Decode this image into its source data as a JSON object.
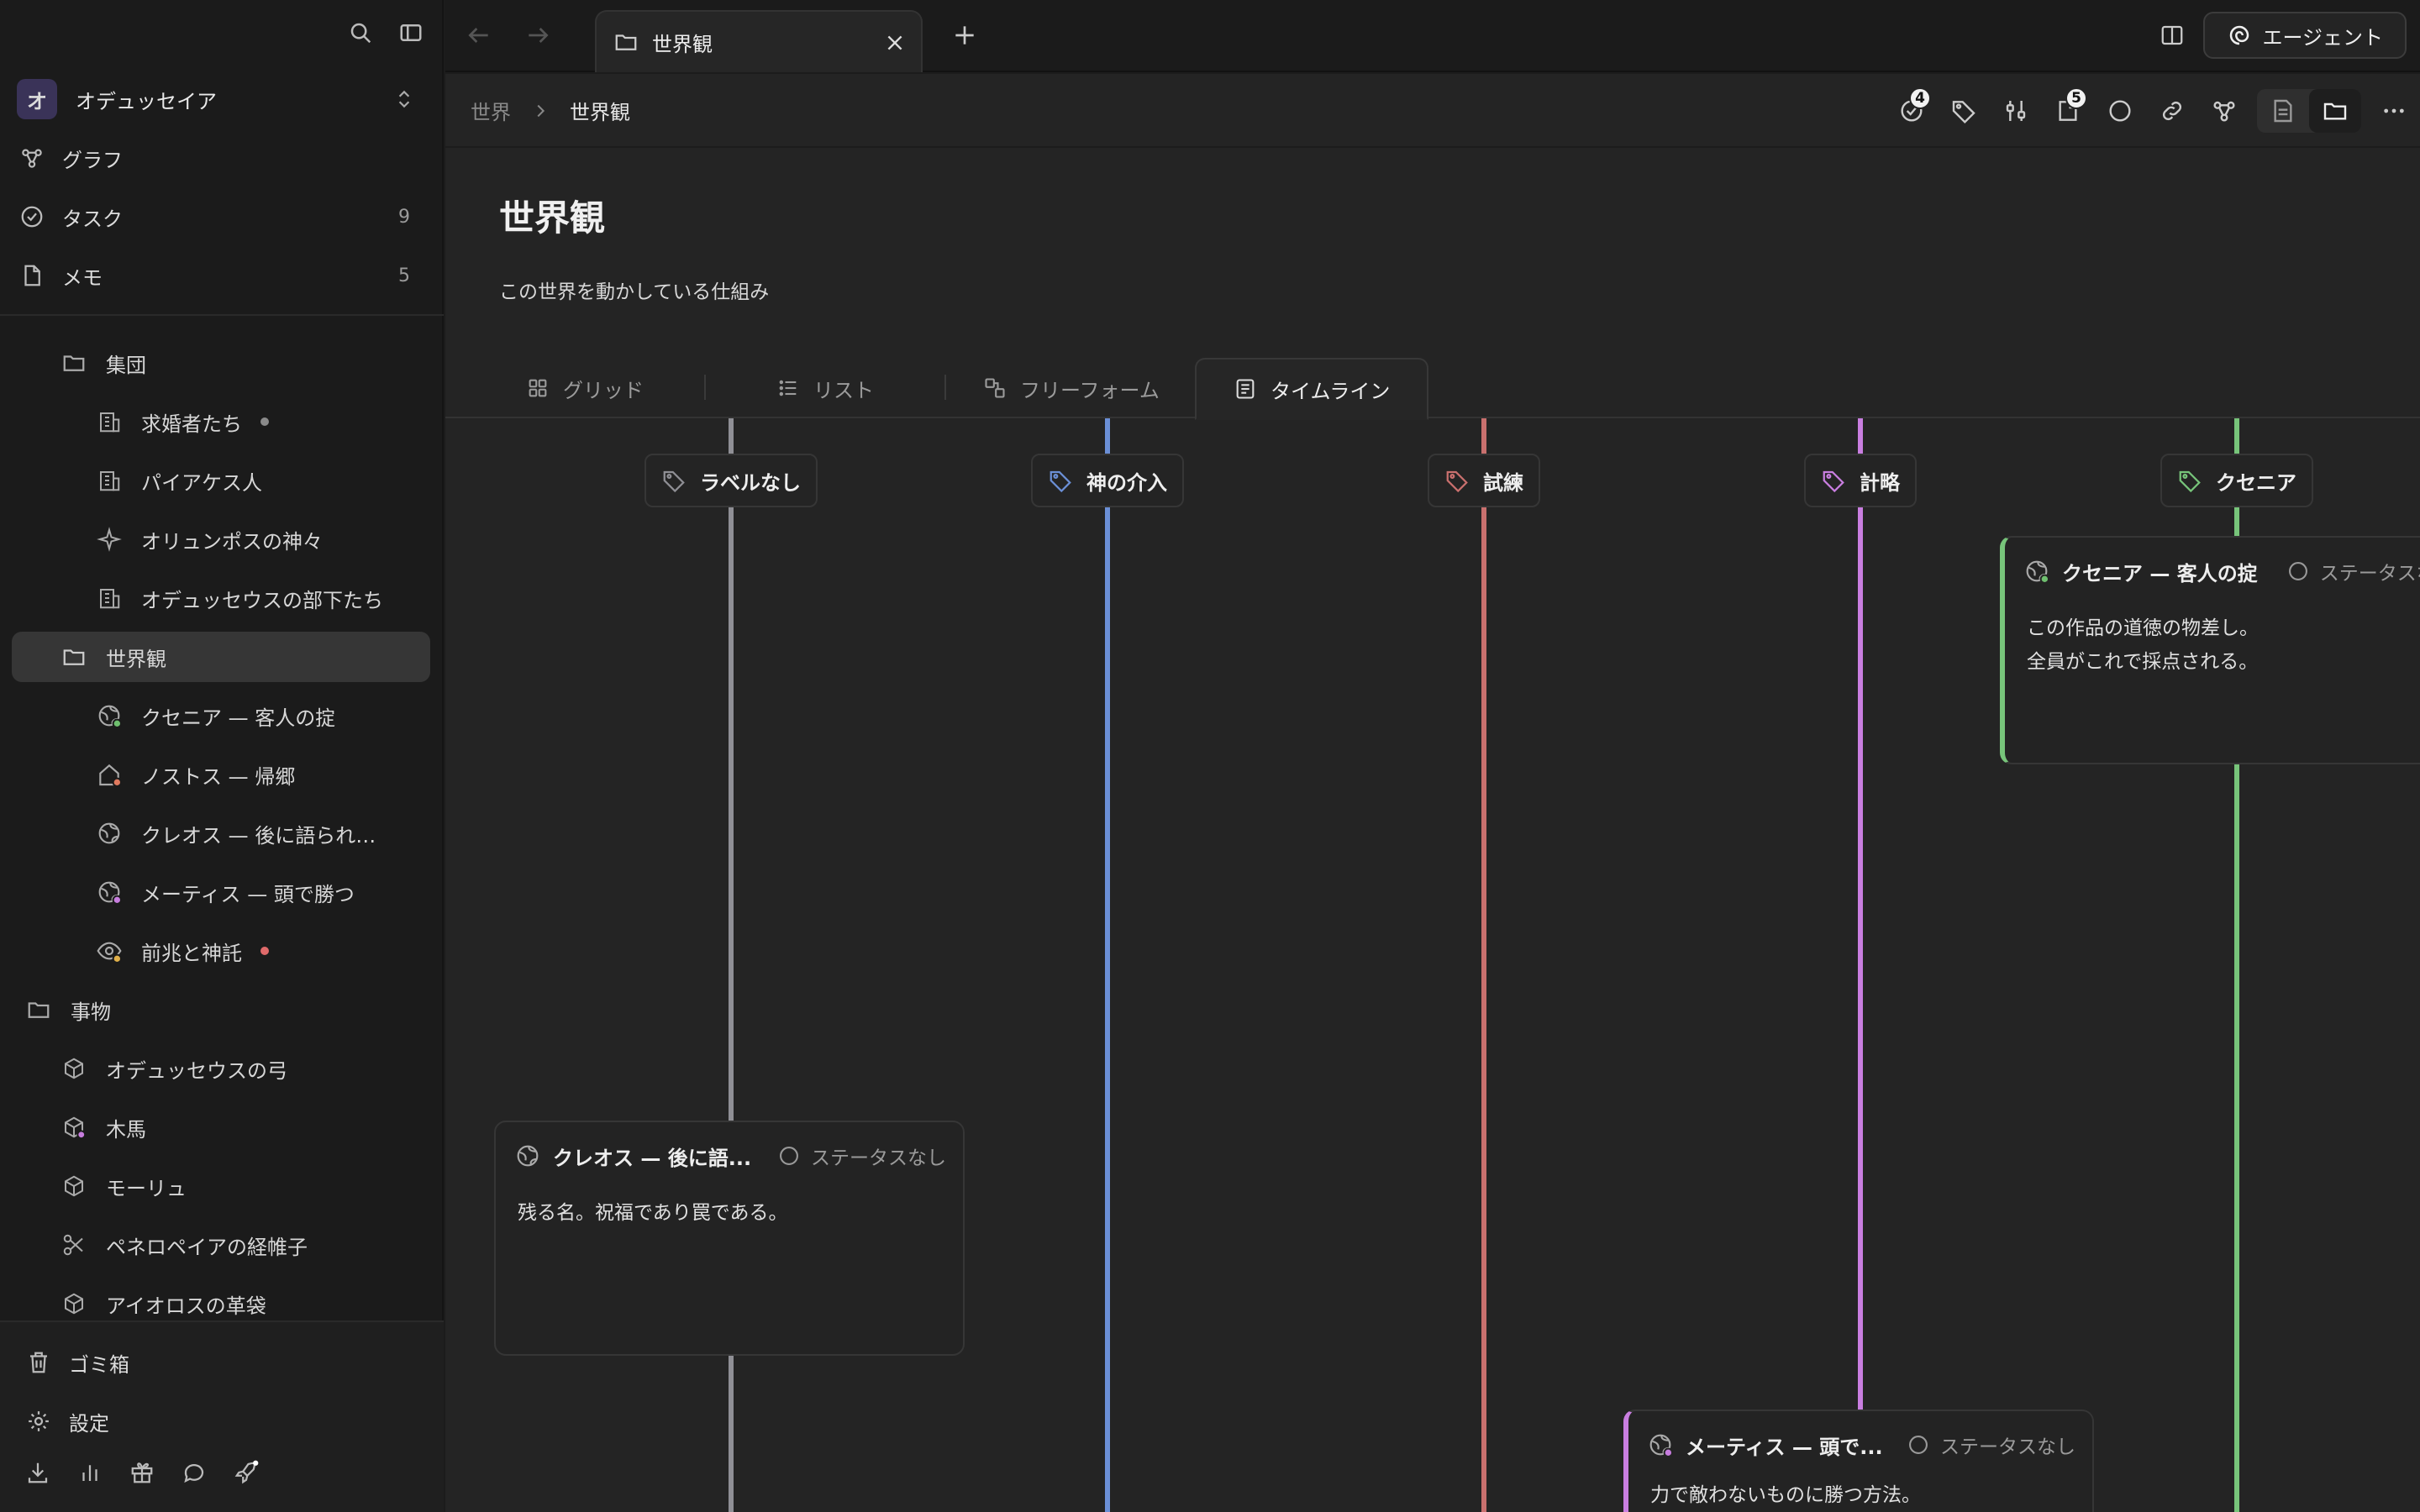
{
  "sidebar": {
    "workspace": {
      "avatar": "オ",
      "name": "オデュッセイア"
    },
    "nav": [
      {
        "label": "グラフ",
        "icon": "graph-icon"
      },
      {
        "label": "タスク",
        "icon": "task-check-icon",
        "count": "9"
      },
      {
        "label": "メモ",
        "icon": "memo-icon",
        "count": "5"
      }
    ],
    "tree": [
      {
        "label": "集団",
        "icon": "folder-icon"
      },
      {
        "label": "求婚者たち",
        "icon": "building-icon",
        "dot": "#8a8a8a"
      },
      {
        "label": "パイアケス人",
        "icon": "building-icon"
      },
      {
        "label": "オリュンポスの神々",
        "icon": "sparkle-icon"
      },
      {
        "label": "オデュッセウスの部下たち",
        "icon": "building-icon"
      },
      {
        "label": "世界観",
        "icon": "folder-icon",
        "selected": true
      },
      {
        "label": "クセニア — 客人の掟",
        "icon": "globe-icon",
        "badge": "#6fbf6f"
      },
      {
        "label": "ノストス — 帰郷",
        "icon": "home-icon",
        "badge": "#e07a5f"
      },
      {
        "label": "クレオス — 後に語られ…",
        "icon": "globe-icon"
      },
      {
        "label": "メーティス — 頭で勝つ",
        "icon": "globe-icon",
        "badge": "#c77dde"
      },
      {
        "label": "前兆と神託",
        "icon": "eye-icon",
        "badge": "#e0b04a",
        "dot": "#e06a6a"
      },
      {
        "label": "事物",
        "icon": "folder-icon"
      },
      {
        "label": "オデュッセウスの弓",
        "icon": "cube-icon"
      },
      {
        "label": "木馬",
        "icon": "cube-icon",
        "badge": "#c77dde"
      },
      {
        "label": "モーリュ",
        "icon": "cube-icon"
      },
      {
        "label": "ペネロペイアの経帷子",
        "icon": "scissors-icon"
      },
      {
        "label": "アイオロスの革袋",
        "icon": "cube-icon"
      }
    ],
    "bottom": [
      {
        "label": "ゴミ箱",
        "icon": "trash-icon"
      },
      {
        "label": "設定",
        "icon": "settings-icon"
      }
    ]
  },
  "tabbar": {
    "tab_title": "世界観",
    "agent_label": "エージェント"
  },
  "breadcrumb": {
    "parent": "世界",
    "current": "世界観"
  },
  "toolbar": {
    "tasks_badge": "4",
    "memos_badge": "5"
  },
  "page": {
    "title": "世界観",
    "description": "この世界を動かしている仕組み"
  },
  "views": [
    {
      "label": "グリッド",
      "icon": "grid-icon"
    },
    {
      "label": "リスト",
      "icon": "list-icon"
    },
    {
      "label": "フリーフォーム",
      "icon": "freeform-icon"
    },
    {
      "label": "タイムライン",
      "icon": "timeline-icon",
      "active": true
    }
  ],
  "lanes": [
    {
      "label": "ラベルなし",
      "color": "#8f8f95"
    },
    {
      "label": "神の介入",
      "color": "#6b8fd6"
    },
    {
      "label": "試練",
      "color": "#c9706e"
    },
    {
      "label": "計略",
      "color": "#c97ee0"
    },
    {
      "label": "クセニア",
      "color": "#77c47a"
    }
  ],
  "cards": [
    {
      "title": "クセニア — 客人の掟",
      "status": "ステータスなし",
      "body": [
        "この作品の道徳の物差し。",
        "全員がこれで採点される。"
      ],
      "accent": "#77c47a"
    },
    {
      "title": "クレオス — 後に語...",
      "status": "ステータスなし",
      "body": [
        "残る名。祝福であり罠である。"
      ]
    },
    {
      "title": "メーティス — 頭で...",
      "status": "ステータスなし",
      "body": [
        "力で敵わないものに勝つ方法。"
      ],
      "accent": "#c97ee0"
    }
  ]
}
